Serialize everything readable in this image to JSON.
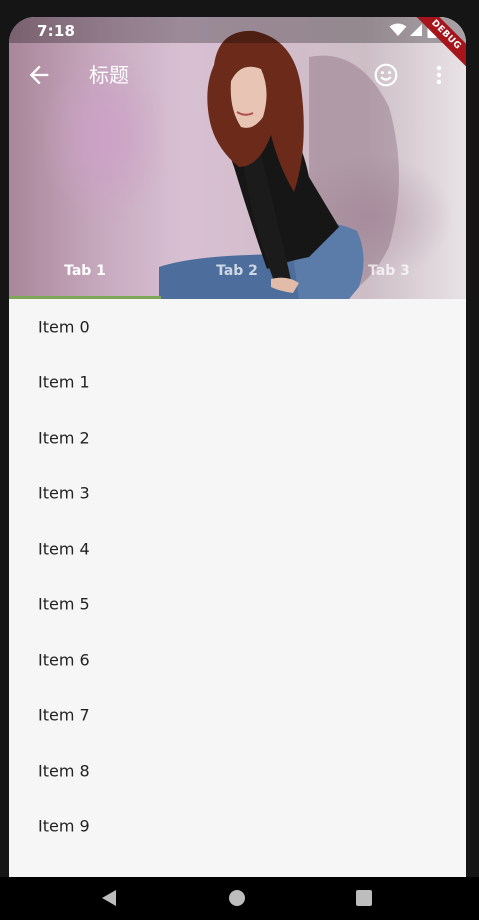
{
  "status_bar": {
    "time": "7:18"
  },
  "app_bar": {
    "title": "标题",
    "debug_banner": "DEBUG"
  },
  "tabs": [
    {
      "label": "Tab 1",
      "selected": true
    },
    {
      "label": "Tab 2",
      "selected": false
    },
    {
      "label": "Tab 3",
      "selected": false
    }
  ],
  "list": {
    "items": [
      "Item 0",
      "Item 1",
      "Item 2",
      "Item 3",
      "Item 4",
      "Item 5",
      "Item 6",
      "Item 7",
      "Item 8",
      "Item 9"
    ]
  },
  "colors": {
    "tab_indicator": "#7ea75a",
    "list_background": "#f6f6f6",
    "debug_banner": "#a6141c"
  },
  "icons": {
    "status": [
      "wifi-icon",
      "signal-icon",
      "battery-icon"
    ],
    "toolbar": [
      "back-arrow-icon",
      "smiley-icon",
      "more-vert-icon"
    ],
    "navigation": [
      "nav-back-icon",
      "nav-home-icon",
      "nav-recents-icon"
    ]
  }
}
